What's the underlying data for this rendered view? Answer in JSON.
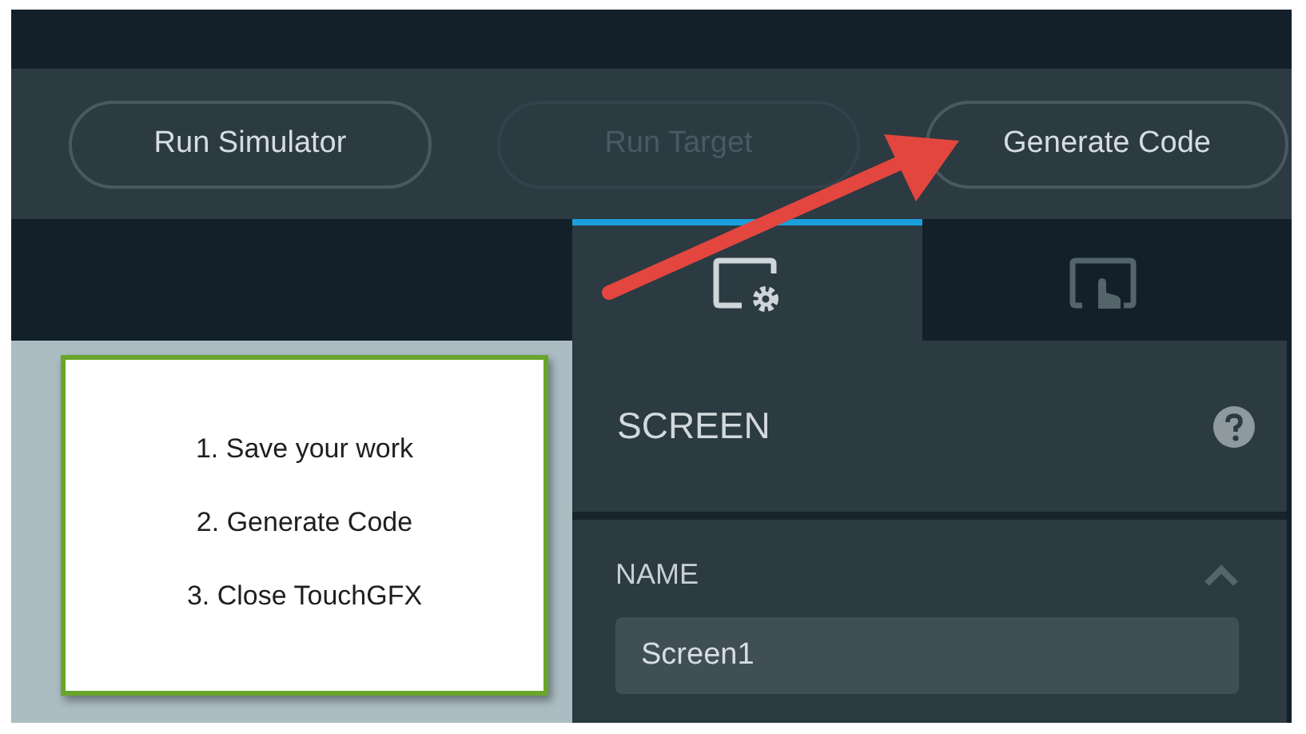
{
  "toolbar": {
    "buttons": [
      {
        "label": "Run Simulator",
        "disabled": false
      },
      {
        "label": "Run Target",
        "disabled": true
      },
      {
        "label": "Generate Code",
        "disabled": false
      }
    ]
  },
  "tabs": [
    {
      "kind": "properties",
      "selected": true
    },
    {
      "kind": "interactions",
      "selected": false
    }
  ],
  "note": {
    "lines": [
      "1. Save your work",
      "2. Generate Code",
      "3. Close TouchGFX"
    ]
  },
  "panel": {
    "title": "SCREEN",
    "section": {
      "title": "NAME",
      "expanded": true,
      "value": "Screen1"
    }
  }
}
